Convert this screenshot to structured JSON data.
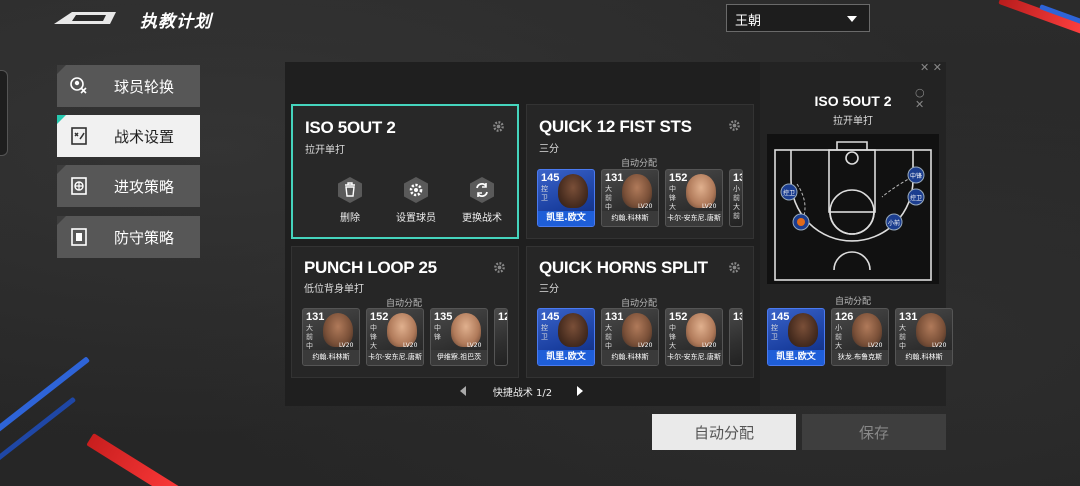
{
  "header": {
    "title": "执教计划",
    "team_select": "王朝"
  },
  "sidebar": {
    "items": [
      {
        "label": "球员轮换",
        "icon": "player-rotation-icon",
        "active": false
      },
      {
        "label": "战术设置",
        "icon": "tactics-board-icon",
        "active": true
      },
      {
        "label": "进攻策略",
        "icon": "offense-strategy-icon",
        "active": false
      },
      {
        "label": "防守策略",
        "icon": "defense-strategy-icon",
        "active": false
      }
    ]
  },
  "plays": [
    {
      "name": "ISO 5OUT 2",
      "type": "拉开单打",
      "selected": true,
      "actions": [
        {
          "label": "删除",
          "icon": "trash-icon"
        },
        {
          "label": "设置球员",
          "icon": "settings-icon"
        },
        {
          "label": "更换战术",
          "icon": "swap-icon"
        }
      ]
    },
    {
      "name": "QUICK 12 FIST STS",
      "type": "三分",
      "auto_label": "自动分配",
      "players": [
        {
          "ovr": "145",
          "pos": "控卫",
          "name": "凯里.欧文",
          "lv": "",
          "star": true
        },
        {
          "ovr": "131",
          "pos": "大前 中锋",
          "name": "约翰.科林斯",
          "lv": "LV20",
          "star": false
        },
        {
          "ovr": "152",
          "pos": "中锋 大前",
          "name": "卡尔-安东尼.唐斯",
          "lv": "LV20",
          "star": false
        },
        {
          "ovr": "13",
          "pos": "小前 大前",
          "name": "",
          "lv": "",
          "star": false
        }
      ]
    },
    {
      "name": "PUNCH LOOP 25",
      "type": "低位背身单打",
      "auto_label": "自动分配",
      "players": [
        {
          "ovr": "131",
          "pos": "大前 中锋",
          "name": "约翰.科林斯",
          "lv": "LV20",
          "star": false
        },
        {
          "ovr": "152",
          "pos": "中锋 大前",
          "name": "卡尔-安东尼.唐斯",
          "lv": "LV20",
          "star": false
        },
        {
          "ovr": "135",
          "pos": "中锋",
          "name": "伊维察.祖巴茨",
          "lv": "LV20",
          "star": false
        },
        {
          "ovr": "12",
          "pos": "",
          "name": "",
          "lv": "",
          "star": false
        }
      ]
    },
    {
      "name": "QUICK HORNS SPLIT",
      "type": "三分",
      "auto_label": "自动分配",
      "players": [
        {
          "ovr": "145",
          "pos": "控卫",
          "name": "凯里.欧文",
          "lv": "",
          "star": true
        },
        {
          "ovr": "131",
          "pos": "大前 中锋",
          "name": "约翰.科林斯",
          "lv": "LV20",
          "star": false
        },
        {
          "ovr": "152",
          "pos": "中锋 大前",
          "name": "卡尔-安东尼.唐斯",
          "lv": "LV20",
          "star": false
        },
        {
          "ovr": "13",
          "pos": "",
          "name": "",
          "lv": "",
          "star": false
        }
      ]
    }
  ],
  "pager": {
    "label": "快捷战术 1/2"
  },
  "preview": {
    "name": "ISO 5OUT 2",
    "type": "拉开单打",
    "auto_label": "自动分配",
    "court_positions": [
      "控卫",
      "中锋",
      "控卫",
      "小前"
    ],
    "players": [
      {
        "ovr": "145",
        "pos": "控卫",
        "name": "凯里.欧文",
        "lv": "",
        "star": true
      },
      {
        "ovr": "126",
        "pos": "小前 大前",
        "name": "狄龙.布鲁克斯",
        "lv": "LV20",
        "star": false
      },
      {
        "ovr": "131",
        "pos": "大前 中锋",
        "name": "约翰.科林斯",
        "lv": "LV20",
        "star": false
      }
    ]
  },
  "buttons": {
    "auto_assign": "自动分配",
    "save": "保存"
  },
  "colors": {
    "accent": "#45d4bd",
    "star_card": "#1e5ed8",
    "active_nav": "#f1f1f1"
  }
}
